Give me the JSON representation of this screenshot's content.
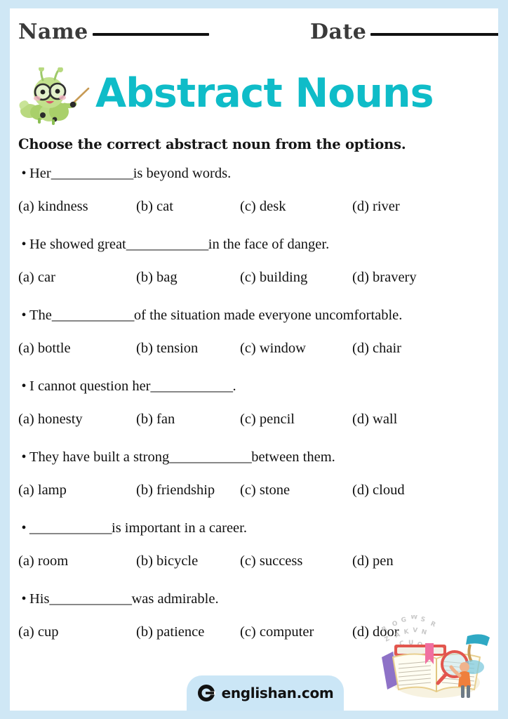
{
  "header": {
    "name_label": "Name",
    "date_label": "Date"
  },
  "title": {
    "text": "Abstract Nouns",
    "color": "#0fbcc8",
    "mascot_icon": "caterpillar-teacher-icon"
  },
  "instruction": "Choose the correct abstract noun from the options.",
  "blank": "____________",
  "questions": [
    {
      "before": "Her ",
      "after": " is beyond words.",
      "options": [
        "(a) kindness",
        "(b) cat",
        "(c) desk",
        "(d) river"
      ]
    },
    {
      "before": "He showed great ",
      "after": " in the face of danger.",
      "options": [
        "(a) car",
        "(b) bag",
        "(c) building",
        "(d) bravery"
      ]
    },
    {
      "before": "The ",
      "after": " of the situation made everyone uncomfortable.",
      "options": [
        "(a) bottle",
        "(b) tension",
        "(c) window",
        "(d) chair"
      ]
    },
    {
      "before": "I cannot question her ",
      "after": ".",
      "options": [
        "(a) honesty",
        "(b) fan",
        "(c) pencil",
        "(d) wall"
      ]
    },
    {
      "before": "They have built a strong ",
      "after": " between them.",
      "options": [
        "(a) lamp",
        "(b) friendship",
        "(c) stone",
        "(d) cloud"
      ]
    },
    {
      "before": " ",
      "after": " is important in a career.",
      "options": [
        "(a) room",
        "(b) bicycle",
        "(c) success",
        "(d) pen"
      ]
    },
    {
      "before": "His ",
      "after": " was admirable.",
      "options": [
        "(a) cup",
        "(b) patience",
        "(c) computer",
        "(d) door"
      ]
    }
  ],
  "footer": {
    "brand": "englishan.com",
    "logo_icon": "englishan-c-logo-icon",
    "pill_color": "#cbe6f6"
  },
  "decoration": {
    "books_icon": "books-magnifier-study-illustration",
    "border_color": "#cfe7f5"
  }
}
